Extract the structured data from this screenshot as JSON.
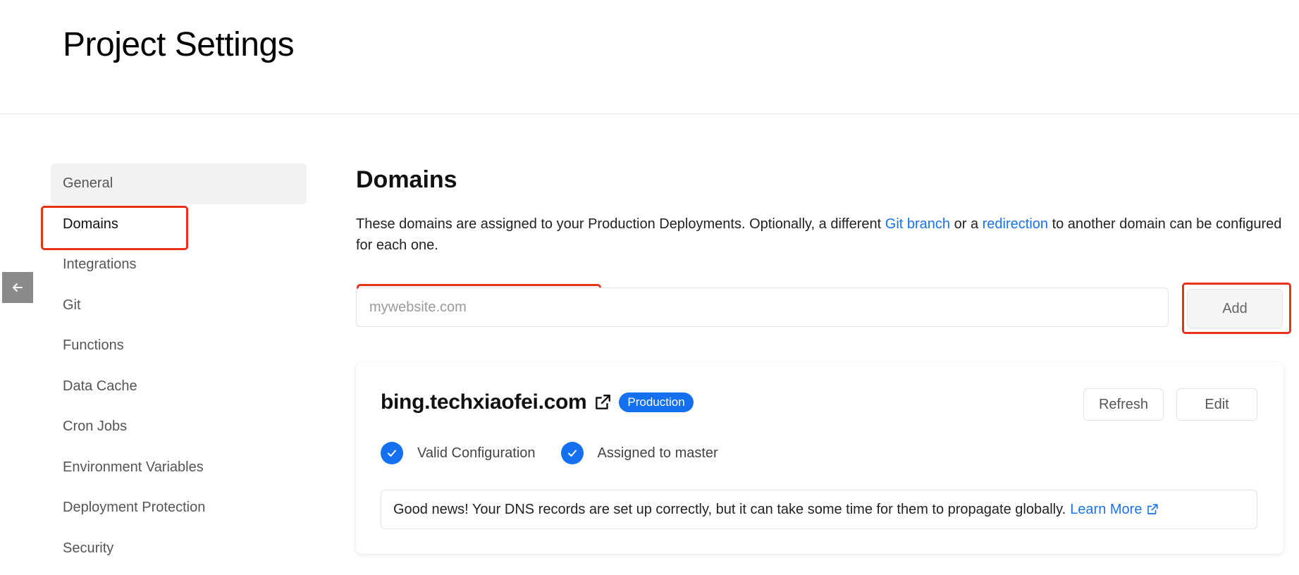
{
  "header": {
    "title": "Project Settings"
  },
  "sidebar": {
    "items": [
      {
        "label": "General"
      },
      {
        "label": "Domains"
      },
      {
        "label": "Integrations"
      },
      {
        "label": "Git"
      },
      {
        "label": "Functions"
      },
      {
        "label": "Data Cache"
      },
      {
        "label": "Cron Jobs"
      },
      {
        "label": "Environment Variables"
      },
      {
        "label": "Deployment Protection"
      },
      {
        "label": "Security"
      }
    ],
    "active": "Domains"
  },
  "main": {
    "title": "Domains",
    "description": {
      "part1": "These domains are assigned to your Production Deployments. Optionally, a different ",
      "link1": "Git branch",
      "part2": " or a ",
      "link2": "redirection",
      "part3": " to another domain can be configured for each one."
    },
    "input": {
      "placeholder": "mywebsite.com",
      "value": ""
    },
    "add_label": "Add"
  },
  "domain_card": {
    "domain": "bing.techxiaofei.com",
    "badge": "Production",
    "refresh_label": "Refresh",
    "edit_label": "Edit",
    "statuses": [
      {
        "label": "Valid Configuration"
      },
      {
        "label": "Assigned to master"
      }
    ],
    "info_text": "Good news! Your DNS records are set up correctly, but it can take some time for them to propagate globally.",
    "info_link": "Learn More"
  },
  "colors": {
    "accent": "#1570ef",
    "link": "#1a73e8",
    "highlight": "#e8321e"
  },
  "icons": {
    "back": "arrow-left-icon",
    "external": "external-link-icon",
    "check": "check-icon"
  }
}
